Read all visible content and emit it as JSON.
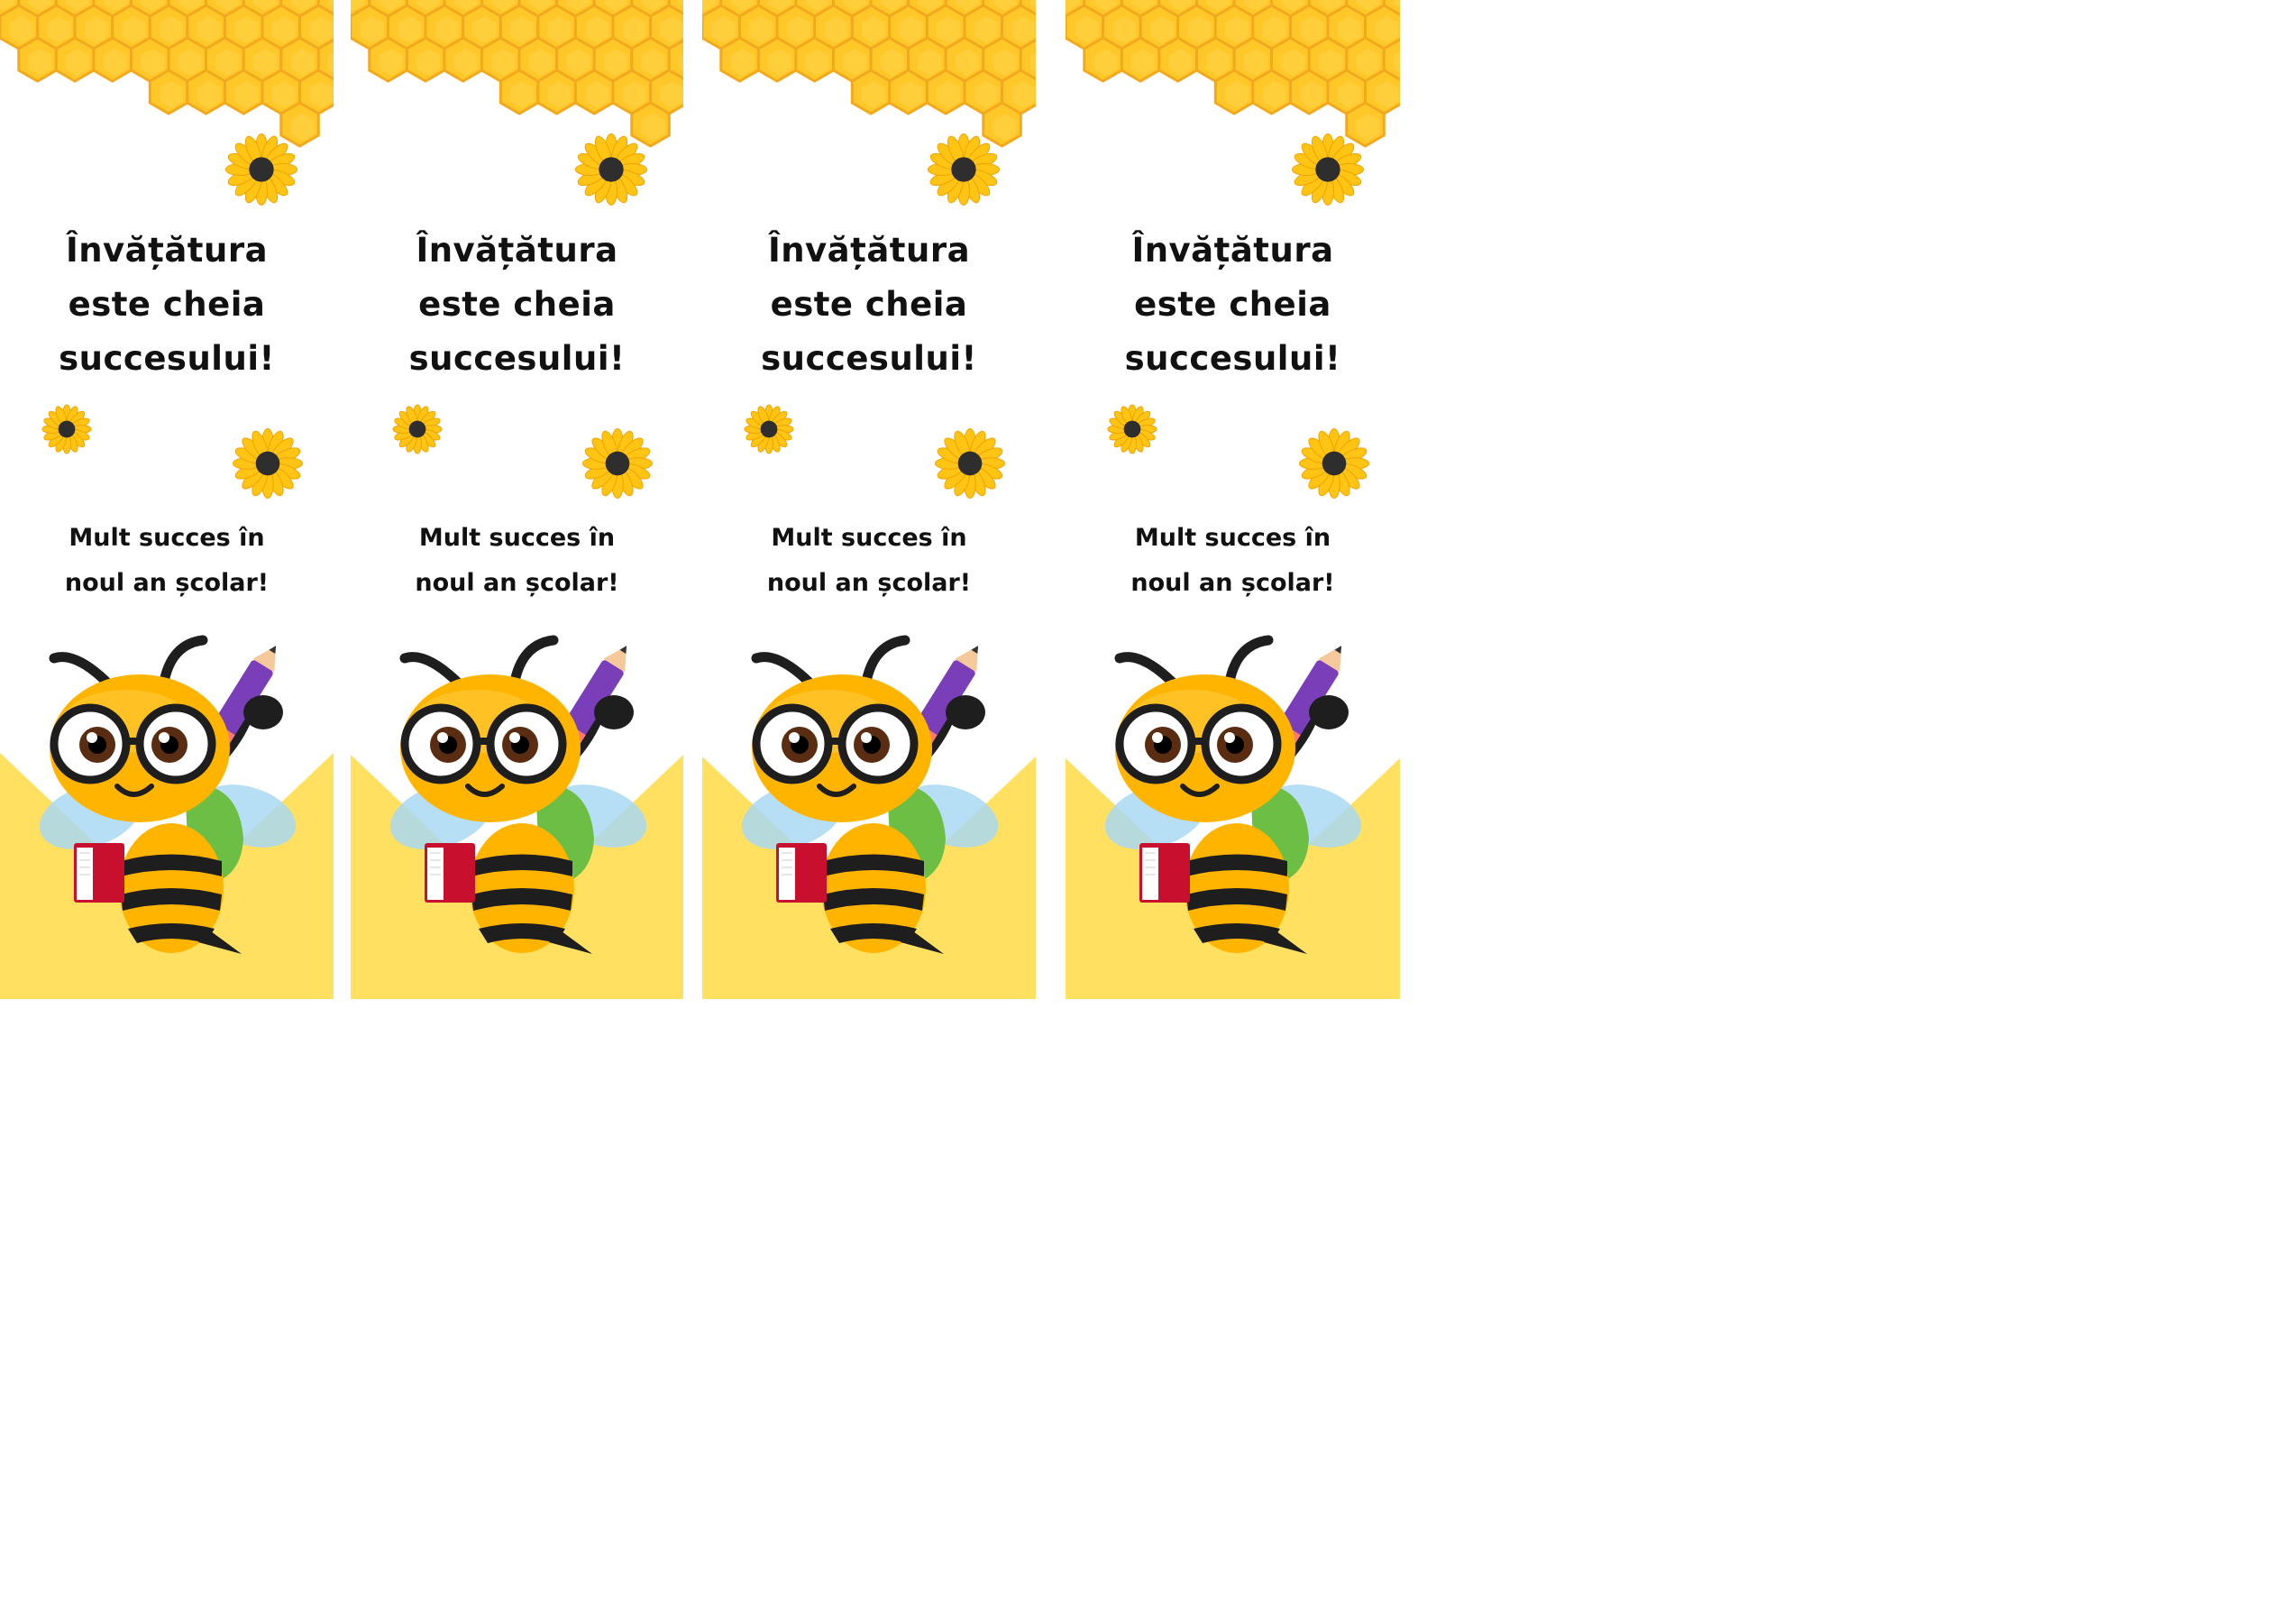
{
  "sheet": {
    "colors": {
      "honeycomb": "#FFC828",
      "honeycomb_edge": "#F2A91E",
      "bottom_panel": "#FFE060",
      "sunflower_petal": "#FFC414",
      "sunflower_center": "#2E2E2E",
      "bee_body": "#FFB400",
      "bee_stripe": "#1E1E1E",
      "pencil": "#7A3FB8",
      "book": "#C8102E",
      "backpack": "#6DBE45",
      "wings": "#A9D8F2",
      "text": "#111111"
    },
    "icons": [
      "honeycomb-pattern",
      "sunflower-icon",
      "bee-student-illustration"
    ]
  },
  "bookmarks": [
    {
      "quote": [
        "Învățătura",
        "este cheia",
        "succesului!"
      ],
      "wish": [
        "Mult succes în",
        "noul an școlar!"
      ]
    },
    {
      "quote": [
        "Învățătura",
        "este cheia",
        "succesului!"
      ],
      "wish": [
        "Mult succes în",
        "noul an școlar!"
      ]
    },
    {
      "quote": [
        "Învățătura",
        "este cheia",
        "succesului!"
      ],
      "wish": [
        "Mult succes în",
        "noul an școlar!"
      ]
    },
    {
      "quote": [
        "Învățătura",
        "este cheia",
        "succesului!"
      ],
      "wish": [
        "Mult succes în",
        "noul an școlar!"
      ]
    }
  ]
}
